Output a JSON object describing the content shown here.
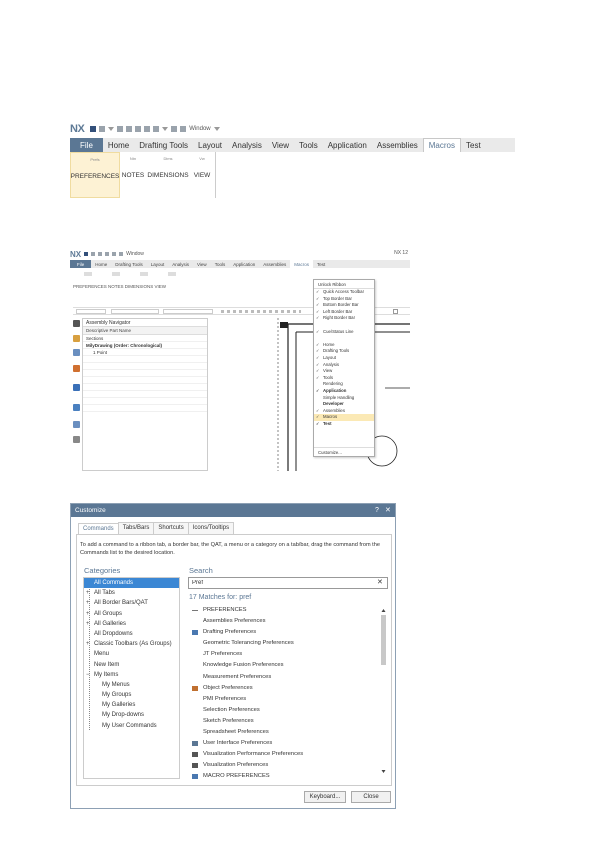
{
  "figure1": {
    "logo": "NX",
    "qat_window_label": "Window",
    "tabs": [
      "File",
      "Home",
      "Drafting Tools",
      "Layout",
      "Analysis",
      "View",
      "Tools",
      "Application",
      "Assemblies",
      "Macros",
      "Test"
    ],
    "active_tab": "Macros",
    "groups": [
      {
        "mini": "Prefs",
        "label": "PREFERENCES"
      },
      {
        "mini": "Ntn",
        "label": "NOTES"
      },
      {
        "mini": "Dims",
        "label": "DIMENSIONS"
      },
      {
        "mini": "Vw",
        "label": "VIEW"
      }
    ]
  },
  "figure2": {
    "logo": "NX",
    "qat_window_label": "Window",
    "right_label": "NX 12",
    "tabs": [
      "File",
      "Home",
      "Drafting Tools",
      "Layout",
      "Analysis",
      "View",
      "Tools",
      "Application",
      "Assemblies",
      "Macros",
      "Test"
    ],
    "active_tab": "Macros",
    "crumb": "PREFERENCES  NOTES  DIMENSIONS  VIEW",
    "nav_header": "Assembly Navigator",
    "nav_column": "Descriptive Part Name",
    "nav_rows": [
      "Sections",
      "MilyDrawing (Order: Chronological)",
      "1 Point"
    ],
    "dropdown_header": "Unlock Ribbon",
    "dropdown_items": [
      {
        "label": "Quick Access Toolbar",
        "checked": true,
        "bold": false
      },
      {
        "label": "Top Border Bar",
        "checked": true,
        "bold": false
      },
      {
        "label": "Bottom Border Bar",
        "checked": true,
        "bold": false
      },
      {
        "label": "Left Border Bar",
        "checked": true,
        "bold": false
      },
      {
        "label": "Right Border Bar",
        "checked": true,
        "bold": false
      },
      {
        "label": "",
        "checked": false,
        "bold": false
      },
      {
        "label": "Cue/Status Line",
        "checked": true,
        "bold": false
      },
      {
        "label": "",
        "checked": false,
        "bold": false
      },
      {
        "label": "Home",
        "checked": true,
        "bold": false
      },
      {
        "label": "Drafting Tools",
        "checked": true,
        "bold": false
      },
      {
        "label": "Layout",
        "checked": true,
        "bold": false
      },
      {
        "label": "Analysis",
        "checked": true,
        "bold": false
      },
      {
        "label": "View",
        "checked": true,
        "bold": false
      },
      {
        "label": "Tools",
        "checked": true,
        "bold": false
      },
      {
        "label": "Rendering",
        "checked": false,
        "bold": false
      },
      {
        "label": "Application",
        "checked": true,
        "bold": true
      },
      {
        "label": "Simple Handling",
        "checked": false,
        "bold": false
      },
      {
        "label": "Developer",
        "checked": false,
        "bold": true
      },
      {
        "label": "Assemblies",
        "checked": true,
        "bold": false
      },
      {
        "label": "Macros",
        "checked": true,
        "bold": false,
        "highlight": true
      },
      {
        "label": "Test",
        "checked": true,
        "bold": true
      }
    ],
    "dropdown_footer": "Customize..."
  },
  "dialog": {
    "title": "Customize",
    "help_glyph": "?",
    "close_glyph": "✕",
    "tabs": [
      "Commands",
      "Tabs/Bars",
      "Shortcuts",
      "Icons/Tooltips"
    ],
    "active_tab": "Commands",
    "instructions": "To add a command to a ribbon tab, a border bar, the QAT, a menu or a category on a tab/bar, drag the command from the Commands list to the desired location.",
    "categories_label": "Categories",
    "categories": [
      {
        "label": "All Commands",
        "expander": "",
        "sub": false,
        "selected": true
      },
      {
        "label": "All Tabs",
        "expander": "+",
        "sub": false,
        "selected": false
      },
      {
        "label": "All Border Bars/QAT",
        "expander": "+",
        "sub": false,
        "selected": false
      },
      {
        "label": "All Groups",
        "expander": "+",
        "sub": false,
        "selected": false
      },
      {
        "label": "All Galleries",
        "expander": "+",
        "sub": false,
        "selected": false
      },
      {
        "label": "All Dropdowns",
        "expander": "",
        "sub": false,
        "selected": false
      },
      {
        "label": "Classic Toolbars (As Groups)",
        "expander": "+",
        "sub": false,
        "selected": false
      },
      {
        "label": "Menu",
        "expander": "",
        "sub": false,
        "selected": false
      },
      {
        "label": "New Item",
        "expander": "",
        "sub": false,
        "selected": false
      },
      {
        "label": "My Items",
        "expander": "−",
        "sub": false,
        "selected": false
      },
      {
        "label": "My Menus",
        "expander": "",
        "sub": true,
        "selected": false
      },
      {
        "label": "My Groups",
        "expander": "",
        "sub": true,
        "selected": false
      },
      {
        "label": "My Galleries",
        "expander": "",
        "sub": true,
        "selected": false
      },
      {
        "label": "My Drop-downs",
        "expander": "",
        "sub": true,
        "selected": false
      },
      {
        "label": "My User Commands",
        "expander": "",
        "sub": true,
        "selected": false
      }
    ],
    "search_label": "Search",
    "search_value": "Pref",
    "search_clear": "✕",
    "matches": "17 Matches for: pref",
    "results": [
      {
        "label": "PREFERENCES",
        "icon": "dash",
        "color": "#777777"
      },
      {
        "label": "Assemblies Preferences",
        "icon": "",
        "color": ""
      },
      {
        "label": "Drafting Preferences",
        "icon": "drafting",
        "color": "#4a78b0"
      },
      {
        "label": "Geometric Tolerancing Preferences",
        "icon": "",
        "color": ""
      },
      {
        "label": "JT Preferences",
        "icon": "",
        "color": ""
      },
      {
        "label": "Knowledge Fusion Preferences",
        "icon": "",
        "color": ""
      },
      {
        "label": "Measurement Preferences",
        "icon": "",
        "color": ""
      },
      {
        "label": "Object Preferences",
        "icon": "object",
        "color": "#c07030"
      },
      {
        "label": "PMI Preferences",
        "icon": "",
        "color": ""
      },
      {
        "label": "Selection Preferences",
        "icon": "",
        "color": ""
      },
      {
        "label": "Sketch Preferences",
        "icon": "",
        "color": ""
      },
      {
        "label": "Spreadsheet Preferences",
        "icon": "",
        "color": ""
      },
      {
        "label": "User Interface Preferences",
        "icon": "ui",
        "color": "#5b7794"
      },
      {
        "label": "Visualization Performance Preferences",
        "icon": "visperf",
        "color": "#555555"
      },
      {
        "label": "Visualization Preferences",
        "icon": "vis",
        "color": "#555555"
      },
      {
        "label": "MACRO PREFERENCES",
        "icon": "macro",
        "color": "#4a78b0"
      }
    ],
    "buttons": {
      "keyboard": "Keyboard...",
      "close": "Close"
    }
  }
}
